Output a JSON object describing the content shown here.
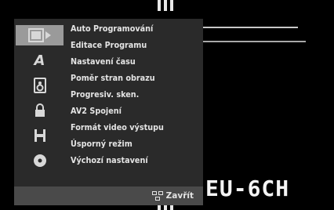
{
  "menu": {
    "items": [
      {
        "label": "Auto Programování"
      },
      {
        "label": "Editace Programu"
      },
      {
        "label": "Nastavení času"
      },
      {
        "label": "Poměr stran obrazu"
      },
      {
        "label": "Progresiv. sken."
      },
      {
        "label": "AV2 Spojení"
      },
      {
        "label": "Formát video výstupu"
      },
      {
        "label": "Úsporný režim"
      },
      {
        "label": "Výchozí nastavení"
      }
    ],
    "sidebar_icons": [
      "settings-icon",
      "language-icon",
      "audio-icon",
      "lock-icon",
      "recording-icon",
      "disc-icon"
    ],
    "sidebar_language_glyph": "A",
    "active_icon": "settings-icon",
    "close_label": "Zavřít"
  },
  "channel_display": "EU-6CH",
  "colors": {
    "menu_background": "#2a2a2a",
    "active_icon_background": "#9a9a9a",
    "footer_background": "#4a4a4a",
    "text": "#e4e4e4"
  }
}
